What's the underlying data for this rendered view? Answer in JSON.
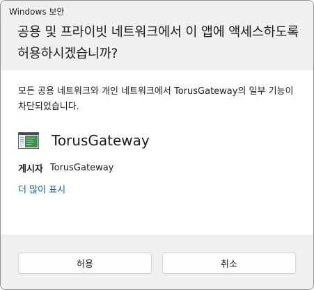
{
  "window": {
    "title": "Windows 보안"
  },
  "header": {
    "heading": "공용 및 프라이빗 네트워크에서 이 앱에 액세스하도록 허용하시겠습니까?"
  },
  "content": {
    "description": "모든 공용 네트워크와 개인 네트워크에서 TorusGateway의 일부 기능이 차단되었습니다.",
    "app": {
      "icon": "application-window-icon",
      "name": "TorusGateway"
    },
    "publisher": {
      "label": "게시자",
      "value": "TorusGateway"
    },
    "more_link": "더 많이 표시"
  },
  "footer": {
    "allow_label": "허용",
    "cancel_label": "취소"
  },
  "colors": {
    "link": "#0b5cad",
    "header_bg": "#f0f0f0",
    "content_bg": "#ffffff"
  }
}
